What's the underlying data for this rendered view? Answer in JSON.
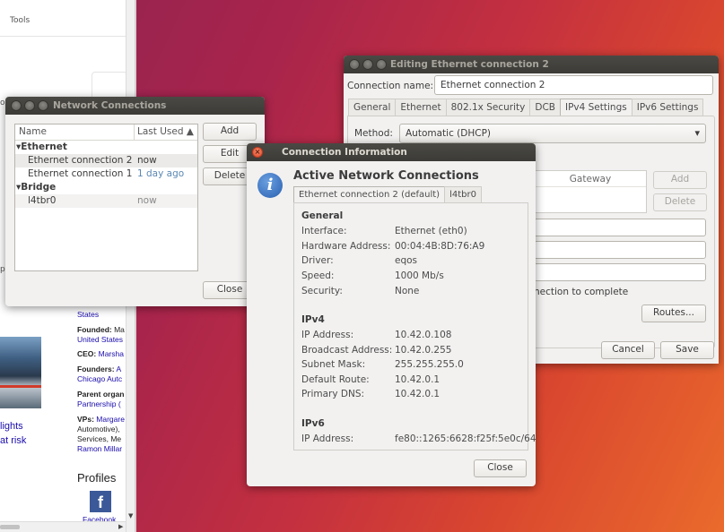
{
  "browser": {
    "tools_label": "Tools",
    "fragment_o": "o",
    "fragment_p": "p",
    "link_1": "lights",
    "link_2": "at risk",
    "info_states": "States",
    "founded_label": "Founded:",
    "founded_value": "Ma",
    "founded_place": "United States",
    "ceo_label": "CEO:",
    "ceo_value": "Marsha",
    "founders_label": "Founders:",
    "founders_value": "A",
    "founders_value2": "Chicago Autc",
    "parent_label": "Parent organ",
    "parent_value": "Partnership (",
    "vps_label": "VPs:",
    "vps_value": "Margare",
    "vps_line2": "Automotive),",
    "vps_line3": "Services, Me",
    "vps_line4": "Ramon Millar",
    "profiles_label": "Profiles",
    "facebook_glyph": "f",
    "facebook_label": "Facebook"
  },
  "edit_window": {
    "title": "Editing Ethernet connection 2",
    "connection_name_label": "Connection name:",
    "connection_name_value": "Ethernet connection 2",
    "tabs": [
      "General",
      "Ethernet",
      "802.1x Security",
      "DCB",
      "IPv4 Settings",
      "IPv6 Settings"
    ],
    "active_tab": "IPv4 Settings",
    "method_label": "Method:",
    "method_value": "Automatic (DHCP)",
    "gateway_header": "Gateway",
    "add_label": "Add",
    "delete_label": "Delete",
    "require_text_fragment": "nection to complete",
    "routes_label": "Routes...",
    "cancel_label": "Cancel",
    "save_label": "Save"
  },
  "network_window": {
    "title": "Network Connections",
    "columns": [
      "Name",
      "Last Used ▲"
    ],
    "rows": [
      {
        "name": "Ethernet",
        "last_used": "",
        "group": true
      },
      {
        "name": "Ethernet connection 2",
        "last_used": "now",
        "group": false
      },
      {
        "name": "Ethernet connection 1",
        "last_used": "1 day ago",
        "group": false
      },
      {
        "name": "Bridge",
        "last_used": "",
        "group": true
      },
      {
        "name": "l4tbr0",
        "last_used": "now",
        "group": false
      }
    ],
    "add_label": "Add",
    "edit_label": "Edit",
    "delete_label": "Delete",
    "close_label": "Close"
  },
  "info_window": {
    "title": "Connection Information",
    "heading": "Active Network Connections",
    "tabs": [
      "Ethernet connection 2 (default)",
      "l4tbr0"
    ],
    "general_title": "General",
    "general": [
      {
        "key": "Interface:",
        "value": "Ethernet (eth0)"
      },
      {
        "key": "Hardware Address:",
        "value": "00:04:4B:8D:76:A9"
      },
      {
        "key": "Driver:",
        "value": "eqos"
      },
      {
        "key": "Speed:",
        "value": "1000 Mb/s"
      },
      {
        "key": "Security:",
        "value": "None"
      }
    ],
    "ipv4_title": "IPv4",
    "ipv4": [
      {
        "key": "IP Address:",
        "value": "10.42.0.108"
      },
      {
        "key": "Broadcast Address:",
        "value": "10.42.0.255"
      },
      {
        "key": "Subnet Mask:",
        "value": "255.255.255.0"
      },
      {
        "key": "Default Route:",
        "value": "10.42.0.1"
      },
      {
        "key": "Primary DNS:",
        "value": "10.42.0.1"
      }
    ],
    "ipv6_title": "IPv6",
    "ipv6": [
      {
        "key": "IP Address:",
        "value": "fe80::1265:6628:f25f:5e0c/64"
      }
    ],
    "close_label": "Close",
    "info_glyph": "i"
  },
  "colors": {
    "titlebar": "#3c3b37",
    "window_bg": "#f2f1f0",
    "close_button": "#e2482a",
    "link_blue": "#1a0dab",
    "timestamp_blue": "#5b88b3"
  }
}
